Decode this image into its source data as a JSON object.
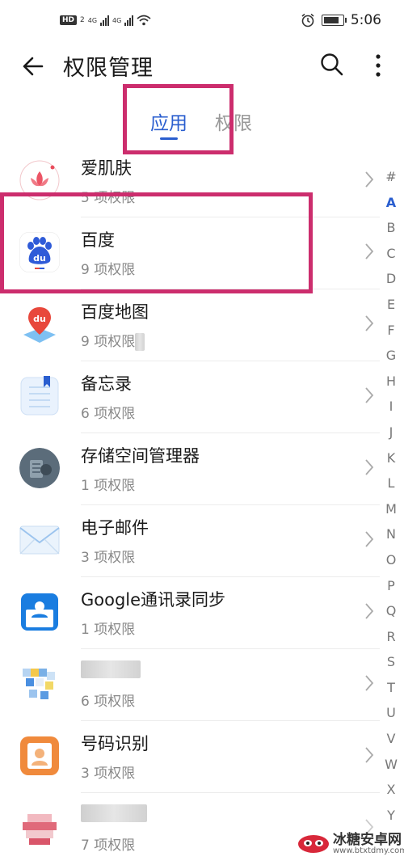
{
  "status_bar": {
    "hd": "HD",
    "hd_sub": "2",
    "net1": "4G",
    "net2": "4G",
    "time": "5:06",
    "icons": [
      "alarm-icon",
      "battery-icon",
      "wifi-icon",
      "signal-icon"
    ]
  },
  "header": {
    "title": "权限管理",
    "icons": [
      "back-arrow-icon",
      "search-icon",
      "more-vertical-icon"
    ]
  },
  "tabs": [
    {
      "label": "应用",
      "active": true
    },
    {
      "label": "权限",
      "active": false
    }
  ],
  "apps": [
    {
      "name": "爱肌肤",
      "perm": "5 项权限",
      "icon": "lotus-icon",
      "color": "#e94b5b"
    },
    {
      "name": "百度",
      "perm": "9 项权限",
      "icon": "baidu-paw-icon",
      "color": "#2f5bd8"
    },
    {
      "name": "百度地图",
      "perm": "9 项权限",
      "icon": "map-pin-icon",
      "color": "#e8483c"
    },
    {
      "name": "备忘录",
      "perm": "6 项权限",
      "icon": "notepad-icon",
      "color": "#9ec3ef"
    },
    {
      "name": "存储空间管理器",
      "perm": "1 项权限",
      "icon": "storage-cleaner-icon",
      "color": "#5b6c7a"
    },
    {
      "name": "电子邮件",
      "perm": "3 项权限",
      "icon": "envelope-icon",
      "color": "#4a8fe0"
    },
    {
      "name": "Google通讯录同步",
      "perm": "1 项权限",
      "icon": "contacts-icon",
      "color": "#1a7de0"
    },
    {
      "name": "",
      "perm": "6 项权限",
      "icon": "blurred-app-icon",
      "color": "#7ab0e6"
    },
    {
      "name": "号码识别",
      "perm": "3 项权限",
      "icon": "caller-id-icon",
      "color": "#f08a3c"
    },
    {
      "name": "",
      "perm": "7 项权限",
      "icon": "blurred-app-icon",
      "color": "#e06a7a"
    }
  ],
  "alphabet": [
    "#",
    "A",
    "B",
    "C",
    "D",
    "E",
    "F",
    "G",
    "H",
    "I",
    "J",
    "K",
    "L",
    "M",
    "N",
    "O",
    "P",
    "Q",
    "R",
    "S",
    "T",
    "U",
    "V",
    "W",
    "X",
    "Y"
  ],
  "active_letter": "A",
  "watermark": {
    "title": "冰糖安卓网",
    "url": "www.btxtdmy.com"
  },
  "colors": {
    "accent": "#2a5ecf",
    "highlight": "#cc2d6d"
  }
}
